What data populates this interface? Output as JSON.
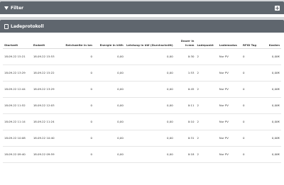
{
  "filter_panel": {
    "title": "Filter"
  },
  "log_panel": {
    "title": "Ladeprotokoll",
    "columns": [
      "Startzeit",
      "Endzeit",
      "Reichweite in km",
      "Energie in kWh",
      "Leistung in kW (Durchschnitt)",
      "Dauer in h:mm",
      "Ladepunkt",
      "Lademodus",
      "RFID Tag",
      "Kosten"
    ],
    "rows": [
      [
        "18.09.22 15:21",
        "18.09.22 15:53",
        "0",
        "0,00",
        "0,00",
        "0:30",
        "2",
        "Nur PV",
        "0",
        "0,00€"
      ],
      [
        "18.09.22 13:29",
        "18.09.22 15:22",
        "0",
        "0,00",
        "0,00",
        "1:53",
        "2",
        "Nur PV",
        "0",
        "0,00€"
      ],
      [
        "18.09.22 12:44",
        "18.09.22 13:29",
        "0",
        "0,00",
        "0,00",
        "0:45",
        "2",
        "Nur PV",
        "0",
        "0,00€"
      ],
      [
        "18.09.22 11:52",
        "18.09.22 12:03",
        "0",
        "0,00",
        "0,00",
        "0:11",
        "2",
        "Nur PV",
        "0",
        "0,00€"
      ],
      [
        "18.09.22 11:14",
        "18.09.22 11:24",
        "0",
        "0,00",
        "0,00",
        "0:10",
        "2",
        "Nur PV",
        "0",
        "0,00€"
      ],
      [
        "18.09.22 10:08",
        "18.09.22 10:40",
        "0",
        "0,00",
        "0,00",
        "0:31",
        "2",
        "Nur PV",
        "0",
        "0,00€"
      ],
      [
        "18.09.22 09:40",
        "18.09.22 09:59",
        "0",
        "0,00",
        "0,00",
        "0:18",
        "2",
        "Nur PV",
        "0",
        "0,00€"
      ]
    ]
  }
}
